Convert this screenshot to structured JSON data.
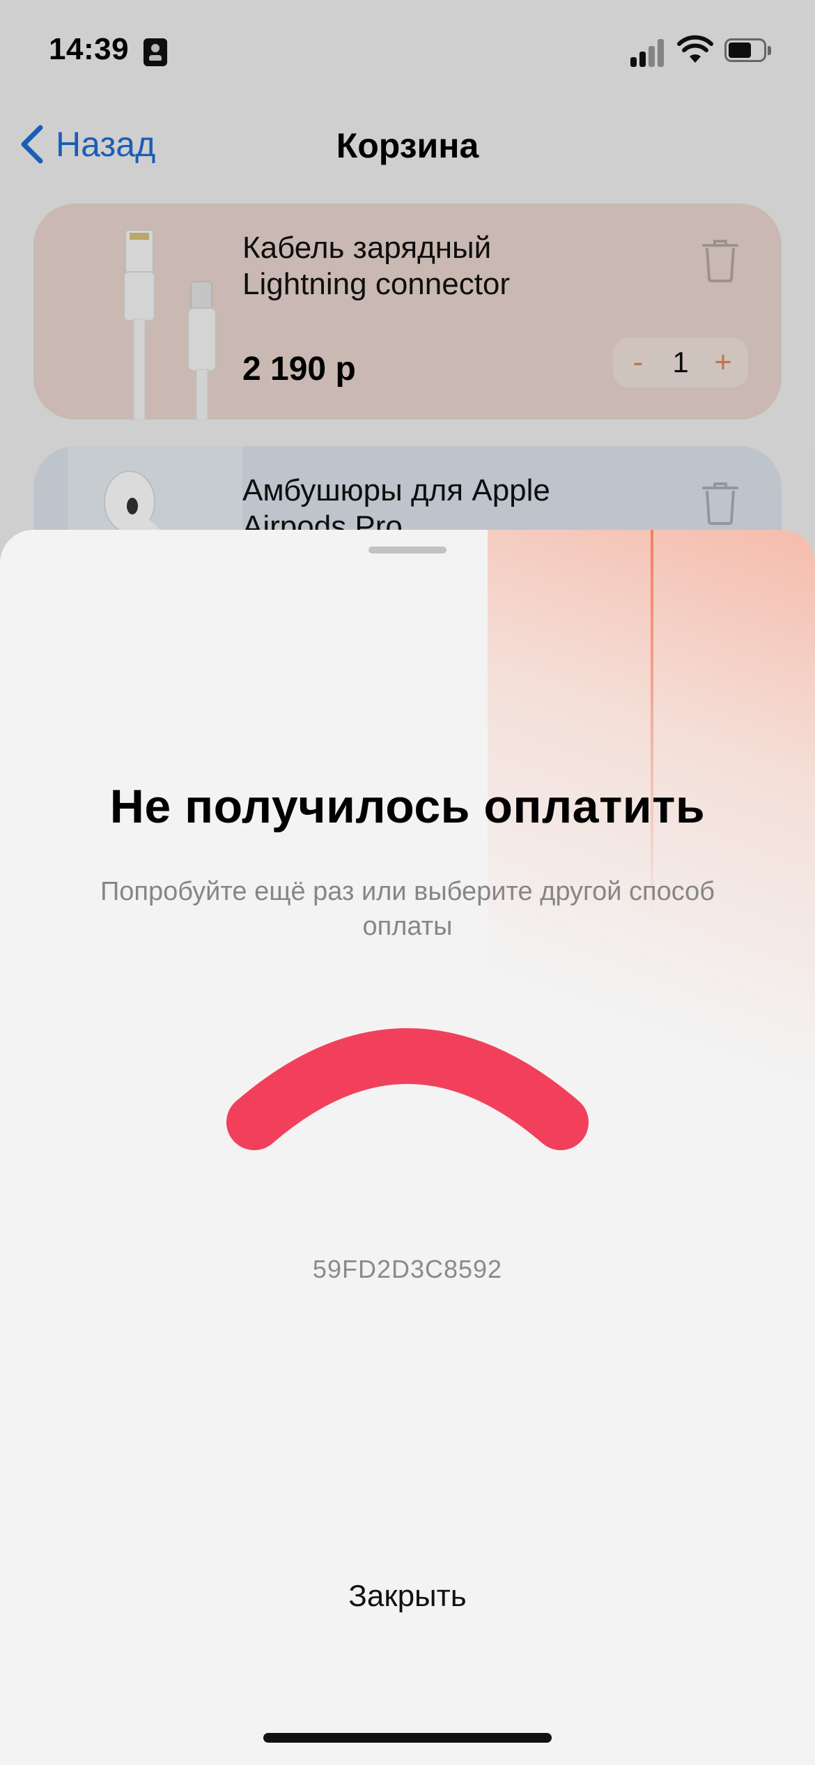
{
  "status_bar": {
    "time": "14:39"
  },
  "nav": {
    "back_label": "Назад",
    "title": "Корзина"
  },
  "cart": {
    "items": [
      {
        "name": "Кабель зарядный Lightning connector",
        "price": "2 190 р",
        "quantity": "1",
        "minus_label": "-",
        "plus_label": "+"
      },
      {
        "name": "Амбушюры для Apple Airpods Pro"
      }
    ]
  },
  "sheet": {
    "title": "Не получилось оплатить",
    "subtitle": "Попробуйте ещё раз или выберите другой способ оплаты",
    "transaction_id": "59FD2D3C8592",
    "close_label": "Закрыть"
  },
  "icons": {
    "back": "chevron-left-icon",
    "trash": "trash-icon",
    "error": "sad-arc-icon"
  },
  "colors": {
    "accent_blue": "#1f6ed4",
    "error_red": "#f2405c",
    "stepper_orange": "#e08a5a",
    "item1_bg": "#ebd8d0",
    "item2_bg": "#dde5ee"
  }
}
